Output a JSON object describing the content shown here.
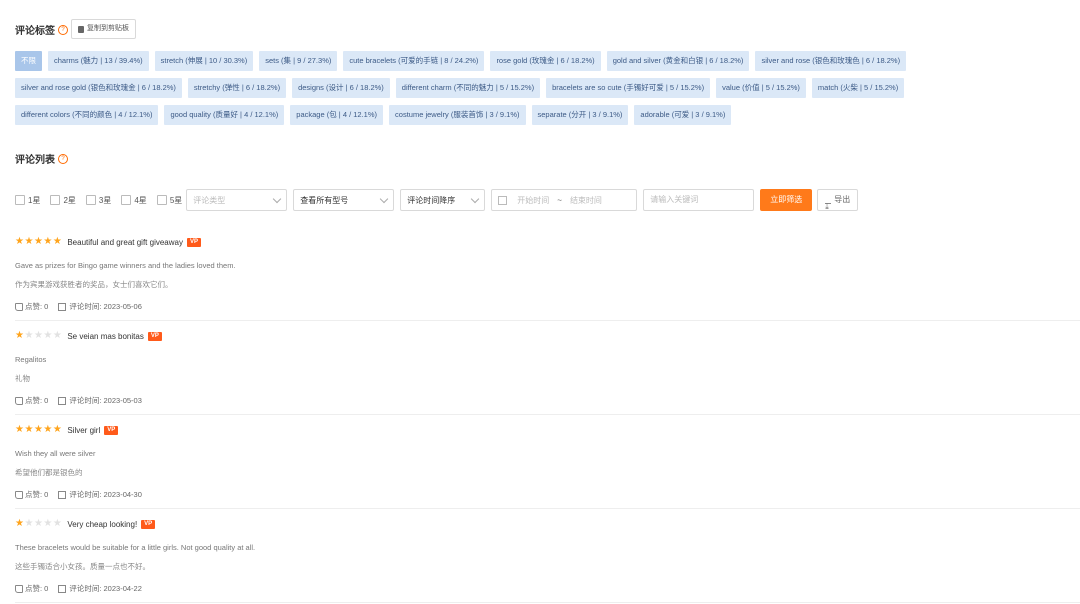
{
  "tags_section": {
    "title": "评论标签",
    "copy_button": "复制到剪贴板"
  },
  "tags": [
    [
      "不限",
      "charms (魅力 | 13 / 39.4%)",
      "stretch (伸展 | 10 / 30.3%)",
      "sets (集 | 9 / 27.3%)",
      "cute bracelets (可爱的手链 | 8 / 24.2%)",
      "rose gold (玫瑰金 | 6 / 18.2%)",
      "gold and silver (黄金和白银 | 6 / 18.2%)",
      "silver and rose (银色和玫瑰色 | 6 / 18.2%)"
    ],
    [
      "silver and rose gold (银色和玫瑰金 | 6 / 18.2%)",
      "stretchy (弹性 | 6 / 18.2%)",
      "designs (设计 | 6 / 18.2%)",
      "different charm (不同的魅力 | 5 / 15.2%)",
      "bracelets are so cute (手镯好可爱 | 5 / 15.2%)",
      "value (价值 | 5 / 15.2%)",
      "match (火柴 | 5 / 15.2%)"
    ],
    [
      "different colors (不同的颜色 | 4 / 12.1%)",
      "good quality (质量好 | 4 / 12.1%)",
      "package (包 | 4 / 12.1%)",
      "costume jewelry (服装首饰 | 3 / 9.1%)",
      "separate (分开 | 3 / 9.1%)",
      "adorable (可爱 | 3 / 9.1%)"
    ]
  ],
  "list_section": {
    "title": "评论列表"
  },
  "filters": {
    "stars": [
      "1星",
      "2星",
      "3星",
      "4星",
      "5星"
    ],
    "review_type_placeholder": "评论类型",
    "model_select": "查看所有型号",
    "sort_select": "评论时间降序",
    "start_placeholder": "开始时间",
    "range_sep": "~",
    "end_placeholder": "结束时间",
    "keyword_placeholder": "请输入关键词",
    "filter_button": "立即筛选",
    "export_button": "导出"
  },
  "reviews": [
    {
      "rating": 5,
      "title": "Beautiful and great gift giveaway",
      "badge": "VP",
      "text": "Gave as prizes for Bingo game winners and the ladies loved them.",
      "translation": "作为宾果游戏获胜者的奖品，女士们喜欢它们。",
      "likes_label": "点赞: 0",
      "time_label": "评论时间: 2023-05-06"
    },
    {
      "rating": 1,
      "title": "Se veian mas bonitas",
      "badge": "VP",
      "text": "Regalitos",
      "translation": "礼物",
      "likes_label": "点赞: 0",
      "time_label": "评论时间: 2023-05-03"
    },
    {
      "rating": 5,
      "title": "Silver girl",
      "badge": "VP",
      "text": "Wish they all were silver",
      "translation": "希望他们都是银色的",
      "likes_label": "点赞: 0",
      "time_label": "评论时间: 2023-04-30"
    },
    {
      "rating": 1,
      "title": "Very cheap looking!",
      "badge": "VP",
      "text": "These bracelets would be suitable for a little girls. Not good quality at all.",
      "translation": "这些手镯适合小女孩。质量一点也不好。",
      "likes_label": "点赞: 0",
      "time_label": "评论时间: 2023-04-22"
    }
  ],
  "colors": {
    "accent": "#ff7a1a",
    "tag_bg": "#dbe8f7",
    "star": "#ffa41c",
    "badge": "#ff5a1a"
  }
}
